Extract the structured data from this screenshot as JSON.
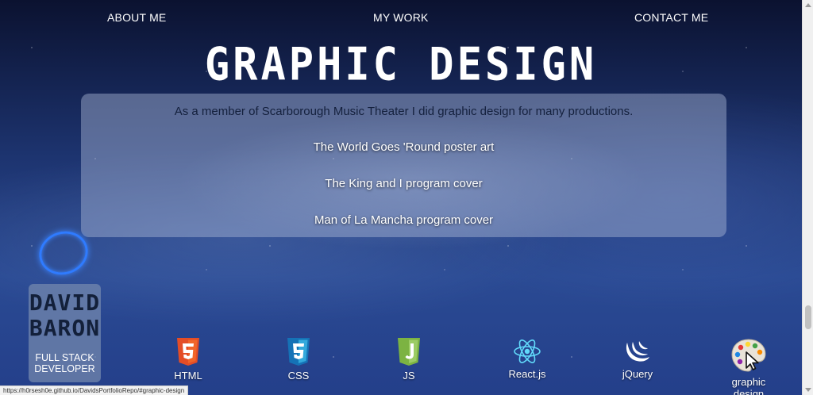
{
  "nav": {
    "about": "ABOUT ME",
    "work": "MY WORK",
    "contact": "CONTACT ME"
  },
  "page_title": "GRAPHIC DESIGN",
  "panel": {
    "intro": "As a member of Scarborough Music Theater I did graphic design for many productions.",
    "items": [
      "The World Goes 'Round poster art",
      "The King and I program cover",
      "Man of La Mancha program cover"
    ]
  },
  "logo": {
    "line1": "DAVID",
    "line2": "BARON",
    "role1": "FULL STACK",
    "role2": "DEVELOPER"
  },
  "skills": [
    {
      "label": "HTML",
      "icon": "html5-icon"
    },
    {
      "label": "CSS",
      "icon": "css3-icon"
    },
    {
      "label": "JS",
      "icon": "javascript-icon"
    },
    {
      "label": "React.js",
      "icon": "react-icon"
    },
    {
      "label": "jQuery",
      "icon": "jquery-icon"
    },
    {
      "label": "graphic design",
      "icon": "palette-icon"
    }
  ],
  "status_url": "https://h0rsesh0e.github.io/DavidsPortfolioRepo/#graphic-design",
  "colors": {
    "html": "#e44d26",
    "css": "#1572b6",
    "js": "#8dc63f",
    "react": "#61dafb",
    "ring": "#2f7bff"
  }
}
